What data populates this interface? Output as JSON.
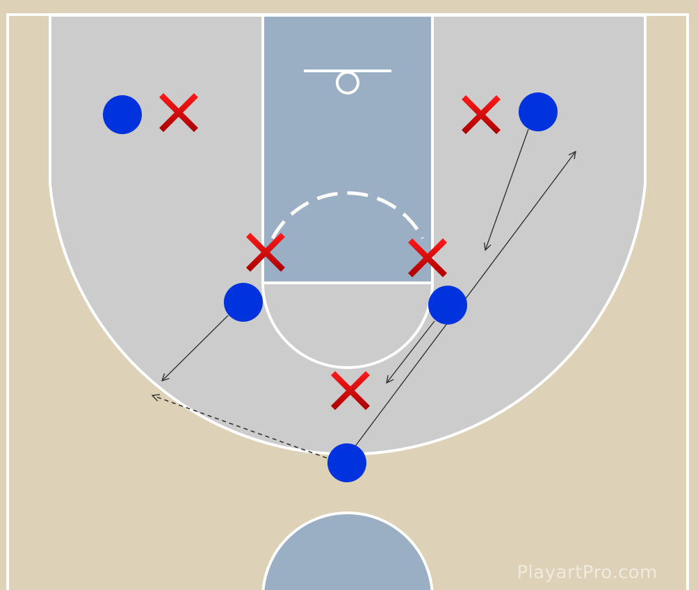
{
  "colors": {
    "court": "#ddd1b7",
    "three_point_area": "#cccccc",
    "paint": "#9aaec4",
    "lines": "#ffffff",
    "offense": "#0033dd",
    "defense": "#e00000",
    "arrow": "#333333"
  },
  "watermark": "PlayartPro.com",
  "offense_marker": "circle",
  "defense_marker": "x-mark"
}
